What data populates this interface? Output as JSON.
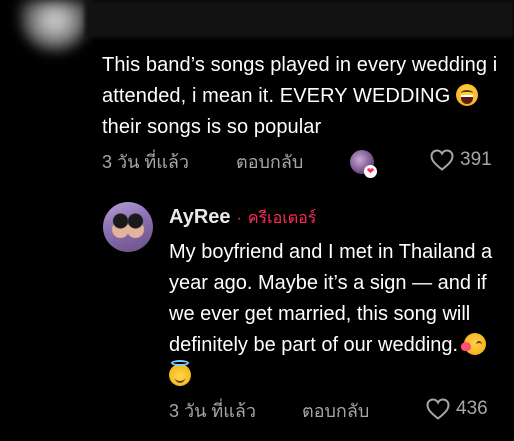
{
  "comment1": {
    "text_before_emoji": "This band’s songs played in every wedding i attended, i mean it. EVERY WEDDING ",
    "emoji": "grinning-squinting-face",
    "text_after_emoji": " their songs is so popular",
    "time": "3 วัน ที่แล้ว",
    "reply_label": "ตอบกลับ",
    "likes": "391",
    "creator_liked_icon": "creator-liked-avatar"
  },
  "comment2": {
    "username": "AyRee",
    "separator": "·",
    "creator_label": "ครีเอเตอร์",
    "text": "My boyfriend and I met in Thailand a year ago. Maybe it’s a sign — and if we ever get married, this song will definitely be part of our wedding. ",
    "emojis": [
      "face-blowing-kiss",
      "smiling-face-with-halo"
    ],
    "time": "3 วัน ที่แล้ว",
    "reply_label": "ตอบกลับ",
    "likes": "436"
  },
  "colors": {
    "background": "#000000",
    "text": "#ffffff",
    "meta": "#a6a6a6",
    "creator_accent": "#fe2c55"
  }
}
